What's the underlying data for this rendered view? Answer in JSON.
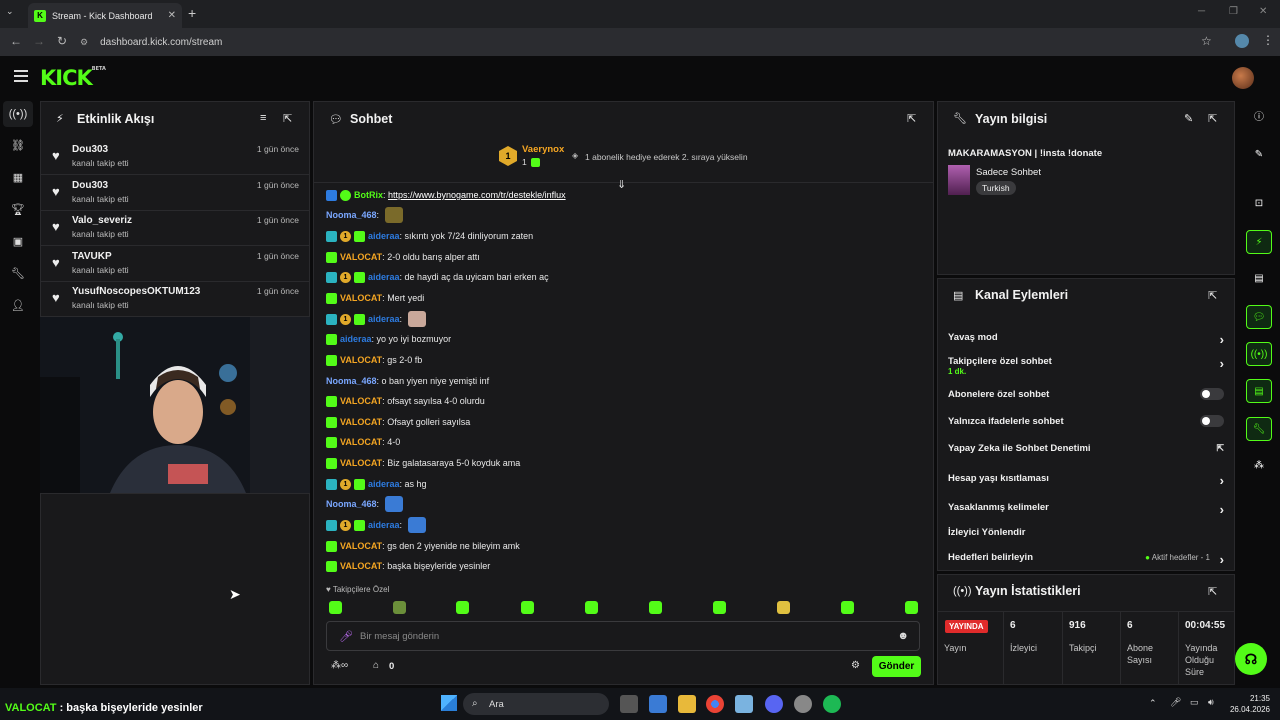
{
  "browser": {
    "tab_title": "Stream - Kick Dashboard",
    "url": "dashboard.kick.com/stream"
  },
  "header": {
    "logo": "KICK",
    "logo_badge": "BETA"
  },
  "activity": {
    "title": "Etkinlik Akışı",
    "items": [
      {
        "user": "Dou303",
        "action": "kanalı takip etti",
        "ago": "1 gün önce"
      },
      {
        "user": "Dou303",
        "action": "kanalı takip etti",
        "ago": "1 gün önce"
      },
      {
        "user": "Valo_severiz",
        "action": "kanalı takip etti",
        "ago": "1 gün önce"
      },
      {
        "user": "TAVUKP",
        "action": "kanalı takip etti",
        "ago": "1 gün önce"
      },
      {
        "user": "YusufNoscopesOKTUM123",
        "action": "kanalı takip etti",
        "ago": "1 gün önce"
      }
    ]
  },
  "chat": {
    "title": "Sohbet",
    "pinned": {
      "user": "Vaerynox",
      "count": "1",
      "text": "1 abonelik hediye ederek 2. sıraya yükselin"
    },
    "messages": [
      {
        "user": "BotRix",
        "color": "#53fc18",
        "badges": [
          "bot",
          "ver"
        ],
        "text": "https://www.bynogame.com/tr/destekle/influx",
        "link": true
      },
      {
        "user": "Nooma_468",
        "color": "#7aa7ff",
        "badges": [],
        "text": "",
        "emote": "#7a6a2a"
      },
      {
        "user": "aideraa",
        "color": "#2d7be0",
        "badges": [
          "og",
          "sub",
          "grn"
        ],
        "text": "sıkıntı yok 7/24 dinliyorum zaten"
      },
      {
        "user": "VALOCAT",
        "color": "#f5a623",
        "badges": [
          "grn"
        ],
        "text": "2-0 oldu barış alper attı"
      },
      {
        "user": "aideraa",
        "color": "#2d7be0",
        "badges": [
          "og",
          "sub",
          "grn"
        ],
        "text": "de haydi aç da uyicam bari erken aç"
      },
      {
        "user": "VALOCAT",
        "color": "#f5a623",
        "badges": [
          "grn"
        ],
        "text": "Mert yedi"
      },
      {
        "user": "aideraa",
        "color": "#2d7be0",
        "badges": [
          "og",
          "sub",
          "grn"
        ],
        "text": "",
        "emote": "#c9a89a"
      },
      {
        "user": "aideraa",
        "color": "#2d7be0",
        "badges": [
          "grn"
        ],
        "text": "yo yo iyi bozmuyor"
      },
      {
        "user": "VALOCAT",
        "color": "#f5a623",
        "badges": [
          "grn"
        ],
        "text": "gs 2-0 fb"
      },
      {
        "user": "Nooma_468",
        "color": "#7aa7ff",
        "badges": [],
        "text": "o ban yiyen niye yemişti inf"
      },
      {
        "user": "VALOCAT",
        "color": "#f5a623",
        "badges": [
          "grn"
        ],
        "text": "ofsayt sayılsa 4-0 olurdu"
      },
      {
        "user": "VALOCAT",
        "color": "#f5a623",
        "badges": [
          "grn"
        ],
        "text": "Ofsayt golleri sayılsa"
      },
      {
        "user": "VALOCAT",
        "color": "#f5a623",
        "badges": [
          "grn"
        ],
        "text": "4-0"
      },
      {
        "user": "VALOCAT",
        "color": "#f5a623",
        "badges": [
          "grn"
        ],
        "text": "Biz galatasaraya 5-0 koyduk ama"
      },
      {
        "user": "aideraa",
        "color": "#2d7be0",
        "badges": [
          "og",
          "sub",
          "grn"
        ],
        "text": "as hg"
      },
      {
        "user": "Nooma_468",
        "color": "#7aa7ff",
        "badges": [],
        "text": "",
        "emote": "#3a7bd5"
      },
      {
        "user": "aideraa",
        "color": "#2d7be0",
        "badges": [
          "og",
          "sub",
          "grn"
        ],
        "text": "",
        "emote": "#3a7bd5"
      },
      {
        "user": "VALOCAT",
        "color": "#f5a623",
        "badges": [
          "grn"
        ],
        "text": "gs den 2 yiyenide ne bileyim amk"
      },
      {
        "user": "VALOCAT",
        "color": "#f5a623",
        "badges": [
          "grn"
        ],
        "text": "başka bişeyleride yesinler"
      }
    ],
    "followers_only": "Takipçilere Özel",
    "input_placeholder": "Bir mesaj gönderin",
    "points_count": "0",
    "send_label": "Gönder"
  },
  "stream_info": {
    "title": "Yayın bilgisi",
    "stream_title": "MAKARAMASYON | !insta !donate",
    "category": "Sadece Sohbet",
    "language": "Turkish"
  },
  "channel_actions": {
    "title": "Kanal Eylemleri",
    "rows": [
      {
        "label": "Yavaş mod",
        "kind": "chevron"
      },
      {
        "label": "Takipçilere özel sohbet",
        "kind": "chevron",
        "sub": "1 dk."
      },
      {
        "label": "Abonelere özel sohbet",
        "kind": "toggle"
      },
      {
        "label": "Yalnızca ifadelerle sohbet",
        "kind": "toggle"
      },
      {
        "label": "Yapay Zeka ile Sohbet Denetimi",
        "kind": "external"
      },
      {
        "label": "Hesap yaşı kısıtlaması",
        "kind": "chevron"
      },
      {
        "label": "Yasaklanmış kelimeler",
        "kind": "chevron"
      },
      {
        "label": "İzleyici Yönlendir",
        "kind": "none"
      },
      {
        "label": "Hedefleri belirleyin",
        "kind": "chevron",
        "extra": "Aktif hedefler - 1"
      }
    ]
  },
  "stats": {
    "title": "Yayın İstatistikleri",
    "live_badge": "YAYINDA",
    "cols": [
      {
        "value": "",
        "label": "Yayın"
      },
      {
        "value": "6",
        "label": "İzleyici"
      },
      {
        "value": "916",
        "label": "Takipçi"
      },
      {
        "value": "6",
        "label": "Abone Sayısı"
      },
      {
        "value": "00:04:55",
        "label": "Yayında Olduğu Süre"
      }
    ]
  },
  "overlay": {
    "user": "VALOCAT",
    "text": " : başka bişeyleride yesinler"
  },
  "taskbar": {
    "search": "Ara",
    "time": "21:35",
    "date": "26.04.2026"
  },
  "colors": {
    "accent": "#53fc18"
  }
}
